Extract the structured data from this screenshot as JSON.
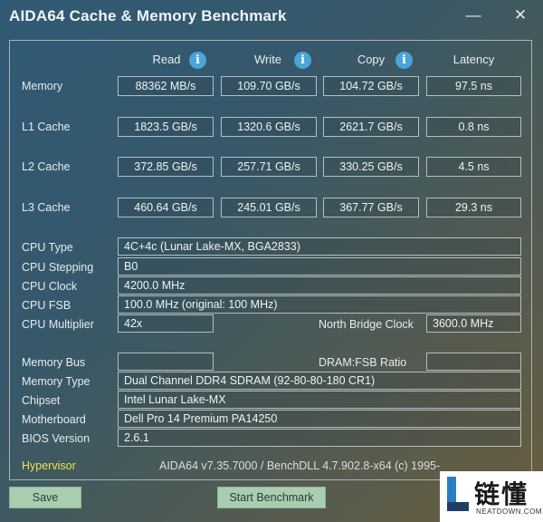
{
  "window": {
    "title": "AIDA64 Cache & Memory Benchmark",
    "minimize_glyph": "—",
    "close_glyph": "✕"
  },
  "columns": {
    "read": "Read",
    "write": "Write",
    "copy": "Copy",
    "latency": "Latency",
    "info_glyph": "i"
  },
  "benchmark": {
    "memory": {
      "label": "Memory",
      "read": "88362 MB/s",
      "write": "109.70 GB/s",
      "copy": "104.72 GB/s",
      "latency": "97.5 ns"
    },
    "l1": {
      "label": "L1 Cache",
      "read": "1823.5 GB/s",
      "write": "1320.6 GB/s",
      "copy": "2621.7 GB/s",
      "latency": "0.8 ns"
    },
    "l2": {
      "label": "L2 Cache",
      "read": "372.85 GB/s",
      "write": "257.71 GB/s",
      "copy": "330.25 GB/s",
      "latency": "4.5 ns"
    },
    "l3": {
      "label": "L3 Cache",
      "read": "460.64 GB/s",
      "write": "245.01 GB/s",
      "copy": "367.77 GB/s",
      "latency": "29.3 ns"
    }
  },
  "cpu": {
    "type_label": "CPU Type",
    "type_value": "4C+4c   (Lunar Lake-MX, BGA2833)",
    "stepping_label": "CPU Stepping",
    "stepping_value": "B0",
    "clock_label": "CPU Clock",
    "clock_value": "4200.0 MHz",
    "fsb_label": "CPU FSB",
    "fsb_value": "100.0 MHz  (original: 100 MHz)",
    "multiplier_label": "CPU Multiplier",
    "multiplier_value": "42x",
    "nb_clock_label": "North Bridge Clock",
    "nb_clock_value": "3600.0 MHz"
  },
  "memory_info": {
    "bus_label": "Memory Bus",
    "bus_value": "",
    "dram_ratio_label": "DRAM:FSB Ratio",
    "dram_ratio_value": "",
    "type_label": "Memory Type",
    "type_value": "Dual Channel DDR4 SDRAM  (92-80-80-180 CR1)",
    "chipset_label": "Chipset",
    "chipset_value": "Intel Lunar Lake-MX",
    "motherboard_label": "Motherboard",
    "motherboard_value": "Dell Pro 14 Premium PA14250",
    "bios_label": "BIOS Version",
    "bios_value": "2.6.1"
  },
  "footer": {
    "hypervisor": "Hypervisor",
    "version_text": "AIDA64 v7.35.7000 / BenchDLL 4.7.902.8-x64  (c) 1995-2025"
  },
  "buttons": {
    "save": "Save",
    "start": "Start Benchmark"
  },
  "watermark": {
    "cn": "链懂",
    "en": "NEATDOWN.COM"
  },
  "colors": {
    "hypervisor": "#f2e14a",
    "info_icon": "#4aa4d8",
    "button_bg": "#a8cdb0"
  }
}
